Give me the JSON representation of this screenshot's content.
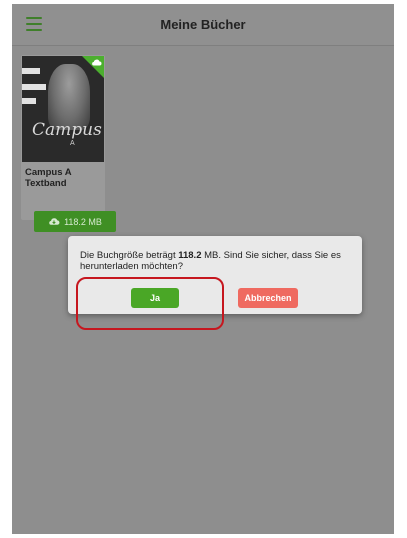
{
  "header": {
    "title": "Meine Bücher",
    "menu_icon": "hamburger-menu-icon"
  },
  "books": [
    {
      "title": "Campus A Textband",
      "cover_logo": "Campus",
      "cover_sub": "A",
      "download_label": "118.2 MB",
      "download_icon": "cloud-download-icon"
    }
  ],
  "dialog": {
    "message_prefix": "Die Buchgröße beträgt ",
    "size": "118.2",
    "message_suffix": " MB. Sind Sie sicher, dass Sie es herunterladen möchten?",
    "confirm_label": "Ja",
    "cancel_label": "Abbrechen"
  },
  "colors": {
    "accent": "#4aa726",
    "cancel": "#ef6a60",
    "highlight": "#c6171f"
  }
}
